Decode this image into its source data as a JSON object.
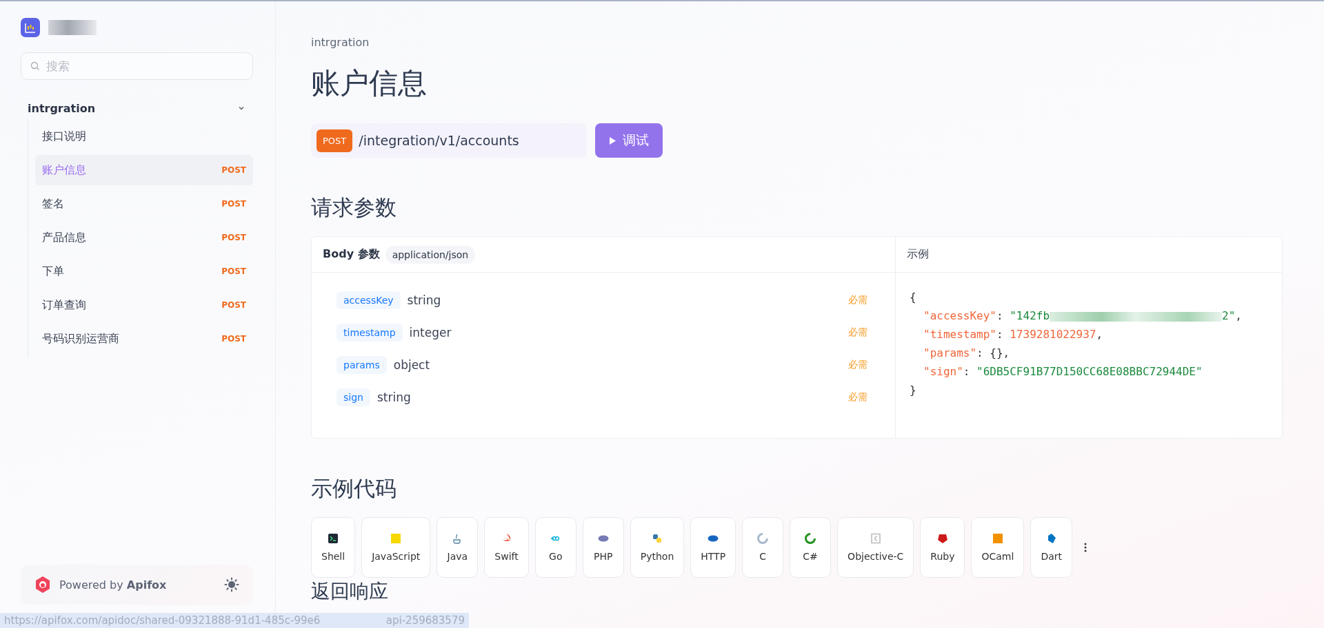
{
  "sidebar": {
    "search": {
      "placeholder": "搜索"
    },
    "group": {
      "label": "intrgration",
      "expanded": true
    },
    "items": [
      {
        "label": "接口说明",
        "selected": false
      },
      {
        "label": "账户信息",
        "method": "POST",
        "selected": true
      },
      {
        "label": "签名",
        "method": "POST",
        "selected": false
      },
      {
        "label": "产品信息",
        "method": "POST",
        "selected": false
      },
      {
        "label": "下单",
        "method": "POST",
        "selected": false
      },
      {
        "label": "订单查询",
        "method": "POST",
        "selected": false
      },
      {
        "label": "号码识别运营商",
        "method": "POST",
        "selected": false
      }
    ],
    "footer": {
      "text": "Powered by **Apifox**"
    }
  },
  "breadcrumb": "intrgration",
  "title": "账户信息",
  "endpoint": {
    "method": "POST",
    "path": "/integration/v1/accounts"
  },
  "run_button": {
    "label": "调试"
  },
  "request": {
    "heading": "请求参数",
    "body_label": "Body 参数",
    "content_type": "application/json",
    "params": [
      {
        "name": "accessKey",
        "type": "string",
        "required": "必需"
      },
      {
        "name": "timestamp",
        "type": "integer",
        "required": "必需"
      },
      {
        "name": "params",
        "type": "object",
        "required": "必需"
      },
      {
        "name": "sign",
        "type": "string",
        "required": "必需"
      }
    ],
    "example_title": "示例",
    "example": {
      "open": "{",
      "close": "}",
      "entries": [
        [
          {
            "kind": "key",
            "text": "\"accessKey\""
          },
          {
            "kind": "punct",
            "text": ": "
          },
          {
            "kind": "string",
            "text": "\"142fb"
          },
          {
            "kind": "redacted"
          },
          {
            "kind": "string",
            "text": "2\""
          },
          {
            "kind": "punct",
            "text": ","
          }
        ],
        [
          {
            "kind": "key",
            "text": "\"timestamp\""
          },
          {
            "kind": "punct",
            "text": ": "
          },
          {
            "kind": "number",
            "text": "1739281022937"
          },
          {
            "kind": "punct",
            "text": ","
          }
        ],
        [
          {
            "kind": "key",
            "text": "\"params\""
          },
          {
            "kind": "punct",
            "text": ": {},"
          }
        ],
        [
          {
            "kind": "key",
            "text": "\"sign\""
          },
          {
            "kind": "punct",
            "text": ": "
          },
          {
            "kind": "string",
            "text": "\"6DB5CF91B77D150CC68E08BBC72944DE\""
          }
        ]
      ]
    }
  },
  "code_samples": {
    "heading": "示例代码",
    "languages": [
      "Shell",
      "JavaScript",
      "Java",
      "Swift",
      "Go",
      "PHP",
      "Python",
      "HTTP",
      "C",
      "C#",
      "Objective-C",
      "Ruby",
      "OCaml",
      "Dart"
    ]
  },
  "response": {
    "heading": "返回响应"
  },
  "status_bar": {
    "url_start": "https://apifox.com/apidoc/shared-09321888-91d1-485c-99e6",
    "url_end": "api-259683579"
  }
}
